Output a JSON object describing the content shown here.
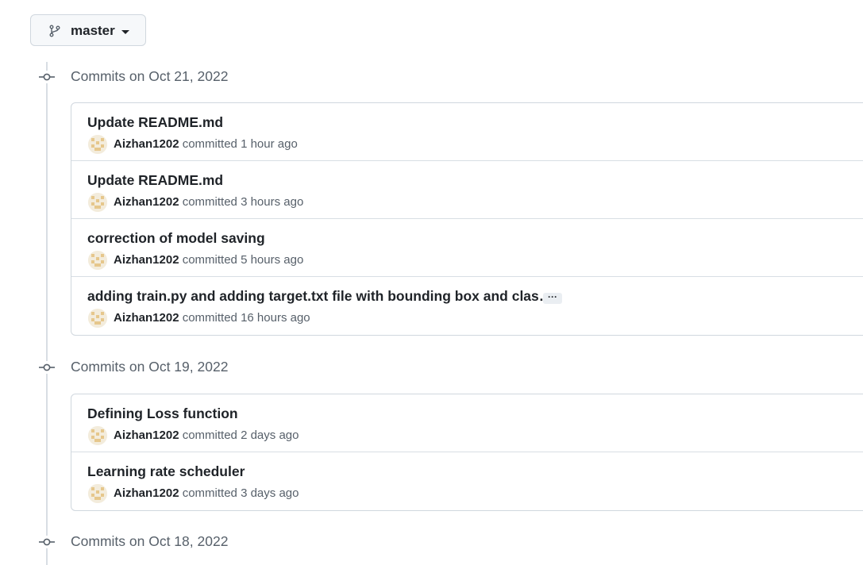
{
  "branch": {
    "name": "master",
    "icon": "git-branch-icon"
  },
  "groups": [
    {
      "title": "Commits on Oct 21, 2022",
      "commits": [
        {
          "title": "Update README.md",
          "author": "Aizhan1202",
          "verb": "committed",
          "time": "1 hour ago"
        },
        {
          "title": "Update README.md",
          "author": "Aizhan1202",
          "verb": "committed",
          "time": "3 hours ago"
        },
        {
          "title": "correction of model saving",
          "author": "Aizhan1202",
          "verb": "committed",
          "time": "5 hours ago"
        },
        {
          "title": "adding train.py and adding target.txt file with bounding box and clas…",
          "author": "Aizhan1202",
          "verb": "committed",
          "time": "16 hours ago",
          "ellipsis": "···"
        }
      ]
    },
    {
      "title": "Commits on Oct 19, 2022",
      "commits": [
        {
          "title": "Defining Loss function",
          "author": "Aizhan1202",
          "verb": "committed",
          "time": "2 days ago"
        },
        {
          "title": "Learning rate scheduler",
          "author": "Aizhan1202",
          "verb": "committed",
          "time": "3 days ago"
        }
      ]
    },
    {
      "title": "Commits on Oct 18, 2022",
      "commits": []
    }
  ],
  "colors": {
    "border": "#d0d7de",
    "muted": "#57606a",
    "text": "#1f2328",
    "avatar_tan": "#e6c78c"
  }
}
